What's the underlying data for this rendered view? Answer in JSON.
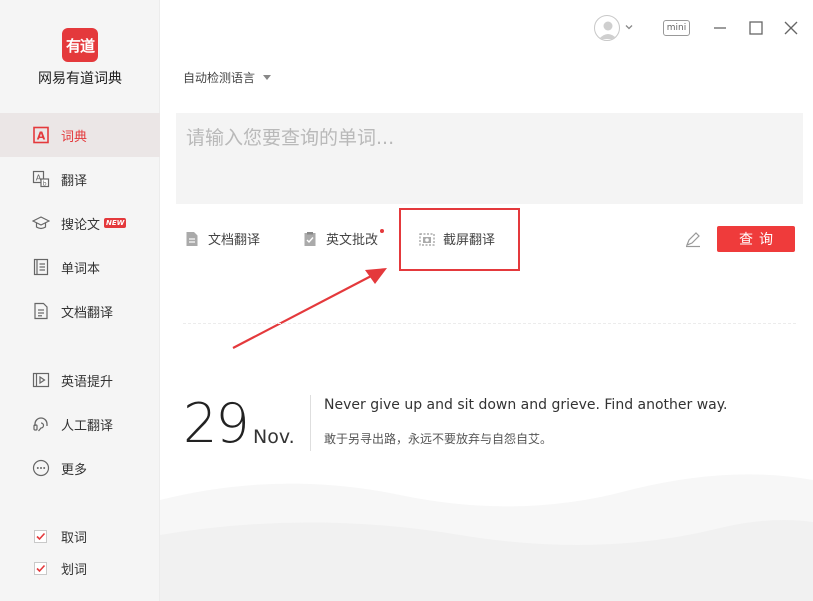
{
  "app": {
    "logo_text": "有道",
    "name": "网易有道词典"
  },
  "sidebar": {
    "items": [
      {
        "label": "词典",
        "icon": "dictionary-icon",
        "active": true
      },
      {
        "label": "翻译",
        "icon": "translate-icon"
      },
      {
        "label": "搜论文",
        "icon": "graduation-cap-icon",
        "badge": "NEW"
      },
      {
        "label": "单词本",
        "icon": "wordbook-icon"
      },
      {
        "label": "文档翻译",
        "icon": "document-icon"
      },
      {
        "label": "英语提升",
        "icon": "video-icon"
      },
      {
        "label": "人工翻译",
        "icon": "headset-icon"
      },
      {
        "label": "更多",
        "icon": "more-icon"
      }
    ],
    "checks": [
      {
        "label": "取词",
        "checked": true
      },
      {
        "label": "划词",
        "checked": true
      }
    ]
  },
  "titlebar": {
    "mini_label": "mini"
  },
  "search": {
    "language": "自动检测语言",
    "placeholder": "请输入您要查询的单词..."
  },
  "tools": {
    "doc_translate": "文档翻译",
    "essay_grading": "英文批改",
    "screenshot_translate": "截屏翻译",
    "query_button": "查询"
  },
  "daily": {
    "day": "29",
    "month": "Nov.",
    "sentence_en": "Never give up and sit down and grieve. Find another way.",
    "sentence_cn": "敢于另寻出路，永远不要放弃与自怨自艾。"
  },
  "colors": {
    "accent": "#e4393c",
    "sidebar_bg": "#f5f5f5",
    "input_bg": "#f4f4f4"
  }
}
